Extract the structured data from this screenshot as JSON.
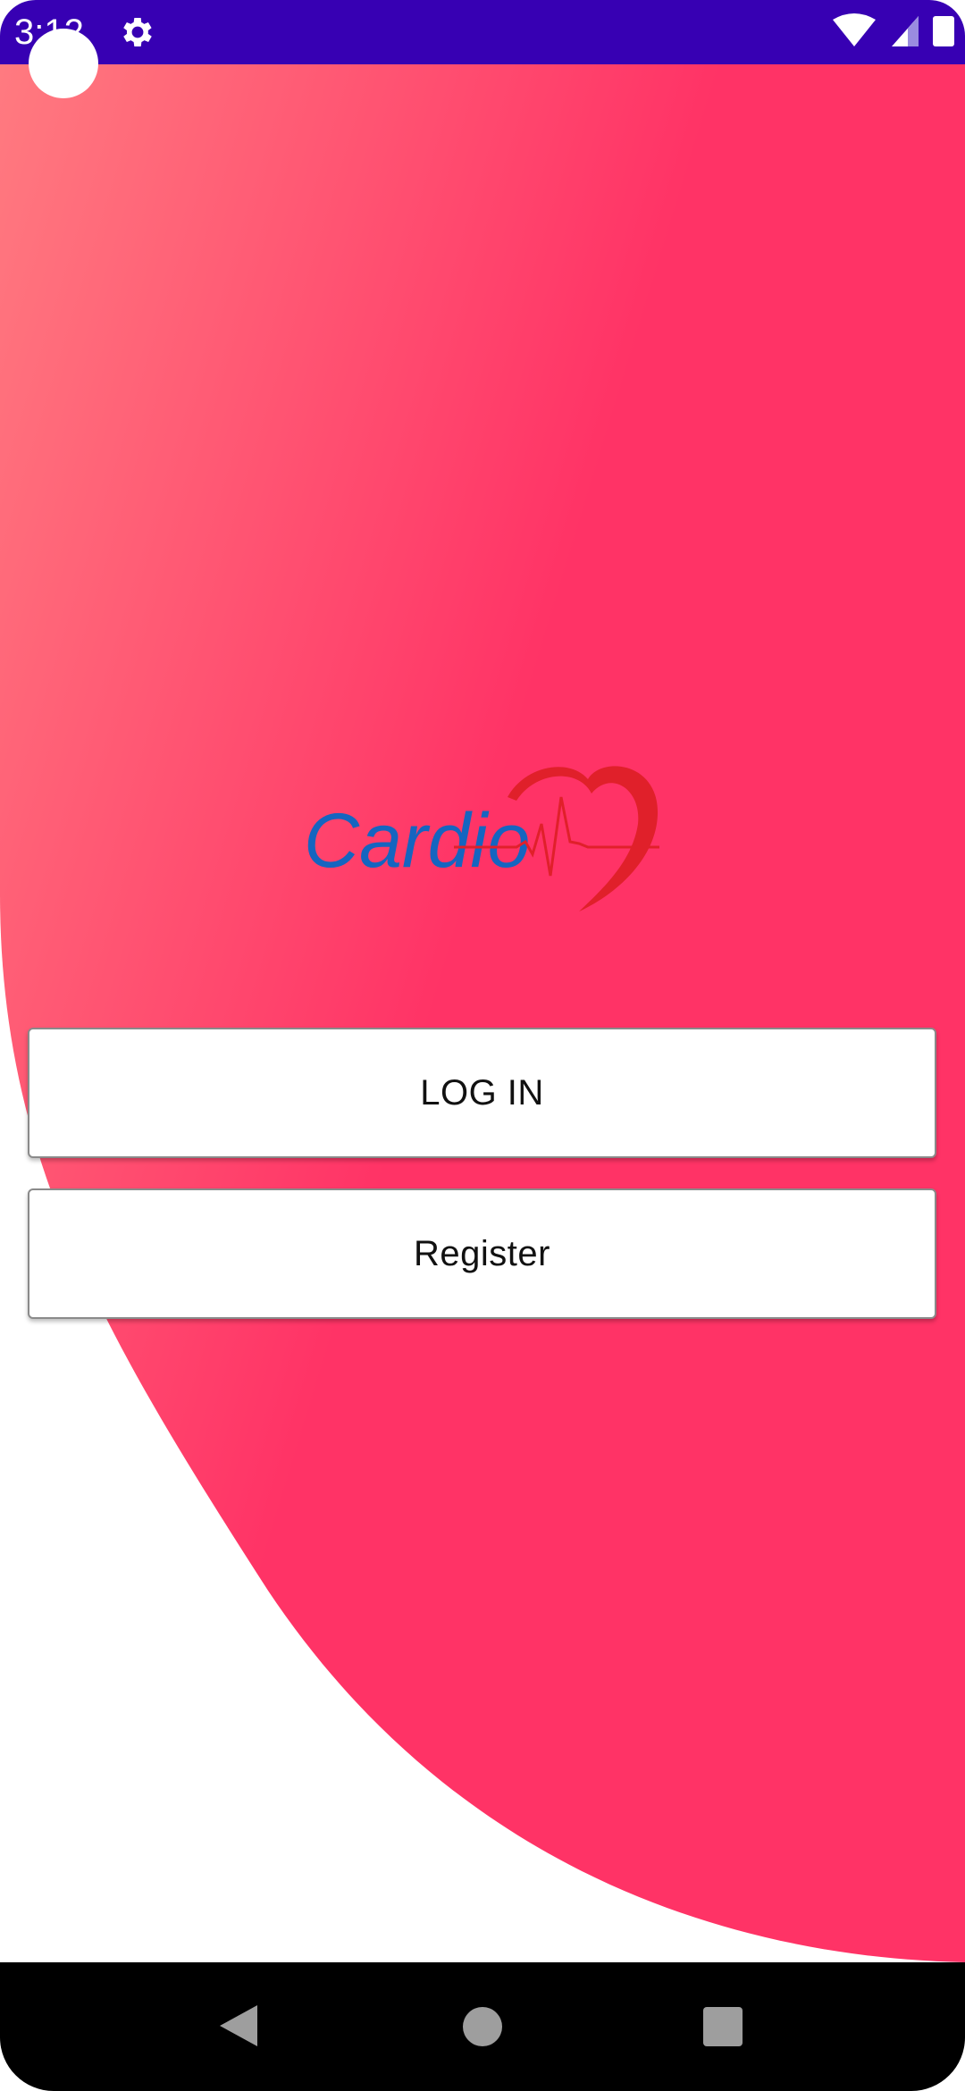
{
  "status_bar": {
    "time": "3:12",
    "settings_icon": "gear-icon",
    "wifi_icon": "wifi-icon",
    "signal_icon": "cell-signal-icon",
    "battery_icon": "battery-icon",
    "color": "#3700b3"
  },
  "background": {
    "gradient_start": "#ff7a80",
    "gradient_end": "#ff3366"
  },
  "logo": {
    "text": "Cardio",
    "text_color": "#1565c0",
    "heart_color": "#e0202a"
  },
  "actions": {
    "login_label": "LOG IN",
    "register_label": "Register"
  },
  "nav_bar": {
    "back_icon": "back-triangle-icon",
    "home_icon": "home-circle-icon",
    "recents_icon": "recents-square-icon"
  }
}
